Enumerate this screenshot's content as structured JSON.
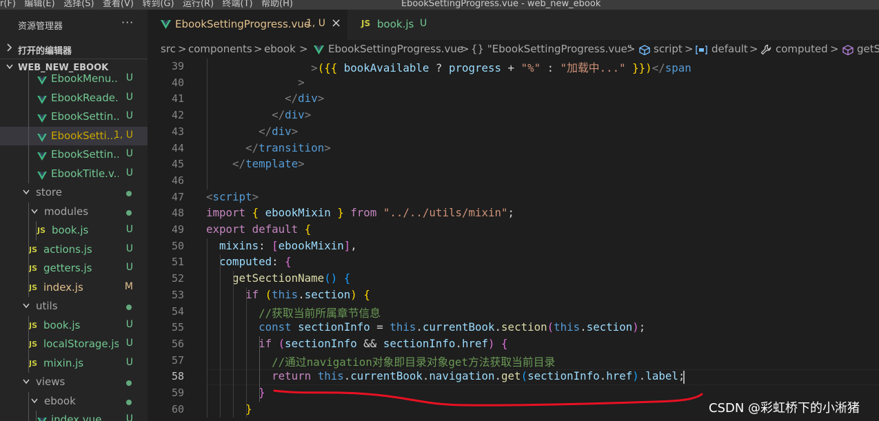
{
  "menubar": {
    "text": "r(F)   编辑(E)   选择(S)   查看(V)   转到(G)   运行(R)   终端(T)   帮助(H)                                      EbookSettingProgress.vue - web_new_ebook"
  },
  "sidebar": {
    "title": "资源管理器",
    "more": "···",
    "open_editors": "打开的编辑器",
    "project": "WEB_NEW_EBOOK",
    "tree": [
      {
        "name": "EbookMenu...",
        "badge": "U",
        "icon": "vue-icon",
        "type": "file",
        "indent": 54
      },
      {
        "name": "EbookReade...",
        "badge": "U",
        "icon": "vue-icon",
        "type": "file",
        "indent": 54
      },
      {
        "name": "EbookSettin...",
        "badge": "U",
        "icon": "vue-icon",
        "type": "file",
        "indent": 54
      },
      {
        "name": "EbookSetti...",
        "badge": "1, U",
        "icon": "vue-icon",
        "type": "file",
        "indent": 54,
        "selected": true
      },
      {
        "name": "EbookSettin...",
        "badge": "U",
        "icon": "vue-icon",
        "type": "file",
        "indent": 54
      },
      {
        "name": "EbookTitle.v...",
        "badge": "U",
        "icon": "vue-icon",
        "type": "file",
        "indent": 54
      },
      {
        "name": "store",
        "badge": "",
        "icon": "chevron-down-icon",
        "type": "folder",
        "indent": 32
      },
      {
        "name": "modules",
        "badge": "",
        "icon": "chevron-down-icon",
        "type": "folder",
        "indent": 44
      },
      {
        "name": "book.js",
        "badge": "U",
        "icon": "js-icon",
        "type": "file",
        "indent": 54
      },
      {
        "name": "actions.js",
        "badge": "U",
        "icon": "js-icon",
        "type": "file",
        "indent": 42
      },
      {
        "name": "getters.js",
        "badge": "U",
        "icon": "js-icon",
        "type": "file",
        "indent": 42
      },
      {
        "name": "index.js",
        "badge": "M",
        "icon": "js-icon",
        "type": "file",
        "indent": 42
      },
      {
        "name": "utils",
        "badge": "",
        "icon": "chevron-down-icon",
        "type": "folder",
        "indent": 32
      },
      {
        "name": "book.js",
        "badge": "U",
        "icon": "js-icon",
        "type": "file",
        "indent": 42
      },
      {
        "name": "localStorage.js",
        "badge": "U",
        "icon": "js-icon",
        "type": "file",
        "indent": 42
      },
      {
        "name": "mixin.js",
        "badge": "U",
        "icon": "js-icon",
        "type": "file",
        "indent": 42
      },
      {
        "name": "views",
        "badge": "",
        "icon": "chevron-down-icon",
        "type": "folder",
        "indent": 32
      },
      {
        "name": "ebook",
        "badge": "",
        "icon": "chevron-down-icon",
        "type": "folder",
        "indent": 44
      },
      {
        "name": "index.vue",
        "badge": "U",
        "icon": "vue-icon",
        "type": "file",
        "indent": 54
      }
    ]
  },
  "tabs": [
    {
      "label": "EbookSettingProgress.vue",
      "status": "1, U",
      "icon": "vue-icon",
      "active": true,
      "close": "×"
    },
    {
      "label": "book.js",
      "status": "U",
      "icon": "js-icon",
      "active": false
    }
  ],
  "breadcrumb": {
    "items": [
      "src",
      "components",
      "ebook",
      "EbookSettingProgress.vue",
      "{} \"EbookSettingProgress.vue\"",
      "script",
      "default",
      "computed",
      "getS"
    ],
    "separator": ">"
  },
  "editor": {
    "current_line": 58,
    "lines": [
      {
        "n": 39,
        "tokens": [
          [
            "pl",
            "                "
          ],
          [
            "punc",
            ">"
          ],
          [
            "b1",
            "("
          ],
          [
            "b1",
            "{{"
          ],
          [
            "pl",
            " "
          ],
          [
            "var",
            "bookAvailable"
          ],
          [
            "pl",
            " ? "
          ],
          [
            "var",
            "progress"
          ],
          [
            "pl",
            " + "
          ],
          [
            "str",
            "\"%\""
          ],
          [
            "pl",
            " : "
          ],
          [
            "str",
            "\"加载中...\""
          ],
          [
            "pl",
            " "
          ],
          [
            "b1",
            "}}"
          ],
          [
            "b1",
            ")"
          ],
          [
            "punc",
            "</"
          ],
          [
            "tag",
            "span"
          ]
        ]
      },
      {
        "n": 40,
        "tokens": [
          [
            "pl",
            "              "
          ],
          [
            "punc",
            ">"
          ]
        ]
      },
      {
        "n": 41,
        "tokens": [
          [
            "pl",
            "            "
          ],
          [
            "punc",
            "</"
          ],
          [
            "tag",
            "div"
          ],
          [
            "punc",
            ">"
          ]
        ]
      },
      {
        "n": 42,
        "tokens": [
          [
            "pl",
            "          "
          ],
          [
            "punc",
            "</"
          ],
          [
            "tag",
            "div"
          ],
          [
            "punc",
            ">"
          ]
        ]
      },
      {
        "n": 43,
        "tokens": [
          [
            "pl",
            "        "
          ],
          [
            "punc",
            "</"
          ],
          [
            "tag",
            "div"
          ],
          [
            "punc",
            ">"
          ]
        ]
      },
      {
        "n": 44,
        "tokens": [
          [
            "pl",
            "      "
          ],
          [
            "punc",
            "</"
          ],
          [
            "tag",
            "transition"
          ],
          [
            "punc",
            ">"
          ]
        ]
      },
      {
        "n": 45,
        "tokens": [
          [
            "pl",
            "    "
          ],
          [
            "punc",
            "</"
          ],
          [
            "tag",
            "template"
          ],
          [
            "punc",
            ">"
          ]
        ]
      },
      {
        "n": 46,
        "tokens": []
      },
      {
        "n": 47,
        "tokens": [
          [
            "punc",
            "<"
          ],
          [
            "tag",
            "script"
          ],
          [
            "punc",
            ">"
          ]
        ]
      },
      {
        "n": 48,
        "tokens": [
          [
            "ctl",
            "import"
          ],
          [
            "pl",
            " "
          ],
          [
            "b1",
            "{"
          ],
          [
            "pl",
            " "
          ],
          [
            "var",
            "ebookMixin"
          ],
          [
            "pl",
            " "
          ],
          [
            "b1",
            "}"
          ],
          [
            "pl",
            " "
          ],
          [
            "ctl",
            "from"
          ],
          [
            "pl",
            " "
          ],
          [
            "str",
            "\"../../utils/mixin\""
          ],
          [
            "pl",
            ";"
          ]
        ]
      },
      {
        "n": 49,
        "tokens": [
          [
            "ctl",
            "export"
          ],
          [
            "pl",
            " "
          ],
          [
            "ctl",
            "default"
          ],
          [
            "pl",
            " "
          ],
          [
            "b1",
            "{"
          ]
        ]
      },
      {
        "n": 50,
        "tokens": [
          [
            "pl",
            "  "
          ],
          [
            "var",
            "mixins"
          ],
          [
            "pl",
            ": "
          ],
          [
            "b2",
            "["
          ],
          [
            "var",
            "ebookMixin"
          ],
          [
            "b2",
            "]"
          ],
          [
            "pl",
            ","
          ]
        ]
      },
      {
        "n": 51,
        "tokens": [
          [
            "pl",
            "  "
          ],
          [
            "var",
            "computed"
          ],
          [
            "pl",
            ": "
          ],
          [
            "b2",
            "{"
          ]
        ]
      },
      {
        "n": 52,
        "tokens": [
          [
            "pl",
            "    "
          ],
          [
            "fn",
            "getSectionName"
          ],
          [
            "b3",
            "()"
          ],
          [
            "pl",
            " "
          ],
          [
            "b3",
            "{"
          ]
        ]
      },
      {
        "n": 53,
        "tokens": [
          [
            "pl",
            "      "
          ],
          [
            "ctl",
            "if"
          ],
          [
            "pl",
            " "
          ],
          [
            "b1",
            "("
          ],
          [
            "kw",
            "this"
          ],
          [
            "pl",
            "."
          ],
          [
            "var",
            "section"
          ],
          [
            "b1",
            ")"
          ],
          [
            "pl",
            " "
          ],
          [
            "b1",
            "{"
          ]
        ]
      },
      {
        "n": 54,
        "tokens": [
          [
            "pl",
            "        "
          ],
          [
            "cm",
            "//获取当前所属章节信息"
          ]
        ]
      },
      {
        "n": 55,
        "tokens": [
          [
            "pl",
            "        "
          ],
          [
            "kw",
            "const"
          ],
          [
            "pl",
            " "
          ],
          [
            "var",
            "sectionInfo"
          ],
          [
            "pl",
            " = "
          ],
          [
            "kw",
            "this"
          ],
          [
            "pl",
            "."
          ],
          [
            "var",
            "currentBook"
          ],
          [
            "pl",
            "."
          ],
          [
            "fn",
            "section"
          ],
          [
            "b2",
            "("
          ],
          [
            "kw",
            "this"
          ],
          [
            "pl",
            "."
          ],
          [
            "var",
            "section"
          ],
          [
            "b2",
            ")"
          ],
          [
            "pl",
            ";"
          ]
        ]
      },
      {
        "n": 56,
        "tokens": [
          [
            "pl",
            "        "
          ],
          [
            "ctl",
            "if"
          ],
          [
            "pl",
            " "
          ],
          [
            "b2",
            "("
          ],
          [
            "var",
            "sectionInfo"
          ],
          [
            "pl",
            " && "
          ],
          [
            "var",
            "sectionInfo"
          ],
          [
            "pl",
            "."
          ],
          [
            "var",
            "href"
          ],
          [
            "b2",
            ")"
          ],
          [
            "pl",
            " "
          ],
          [
            "b2",
            "{"
          ]
        ]
      },
      {
        "n": 57,
        "tokens": [
          [
            "pl",
            "          "
          ],
          [
            "cm",
            "//通过navigation对象即目录对象get方法获取当前目录"
          ]
        ]
      },
      {
        "n": 58,
        "tokens": [
          [
            "pl",
            "          "
          ],
          [
            "ctl",
            "return"
          ],
          [
            "pl",
            " "
          ],
          [
            "kw",
            "this"
          ],
          [
            "pl",
            "."
          ],
          [
            "var",
            "currentBook"
          ],
          [
            "pl",
            "."
          ],
          [
            "var",
            "navigation"
          ],
          [
            "pl",
            "."
          ],
          [
            "fn",
            "get"
          ],
          [
            "b3",
            "("
          ],
          [
            "var",
            "sectionInfo"
          ],
          [
            "pl",
            "."
          ],
          [
            "var",
            "href"
          ],
          [
            "b3",
            ")"
          ],
          [
            "pl",
            "."
          ],
          [
            "var",
            "label"
          ],
          [
            "pl",
            ";"
          ]
        ]
      },
      {
        "n": 59,
        "tokens": [
          [
            "pl",
            "        "
          ],
          [
            "b2",
            "}"
          ]
        ]
      },
      {
        "n": 60,
        "tokens": [
          [
            "pl",
            "      "
          ],
          [
            "b1",
            "}"
          ]
        ]
      }
    ]
  },
  "annotation": {
    "color": "#e81123"
  },
  "watermark": "CSDN @彩虹桥下的小淅猪",
  "colors": {
    "sidebar_bg": "#252526",
    "editor_bg": "#1e1e1e",
    "untracked": "#73c991",
    "modified": "#e2c08d",
    "warning": "#cca700",
    "vue_icon": "#41b883",
    "js_icon": "#cbcb41"
  }
}
